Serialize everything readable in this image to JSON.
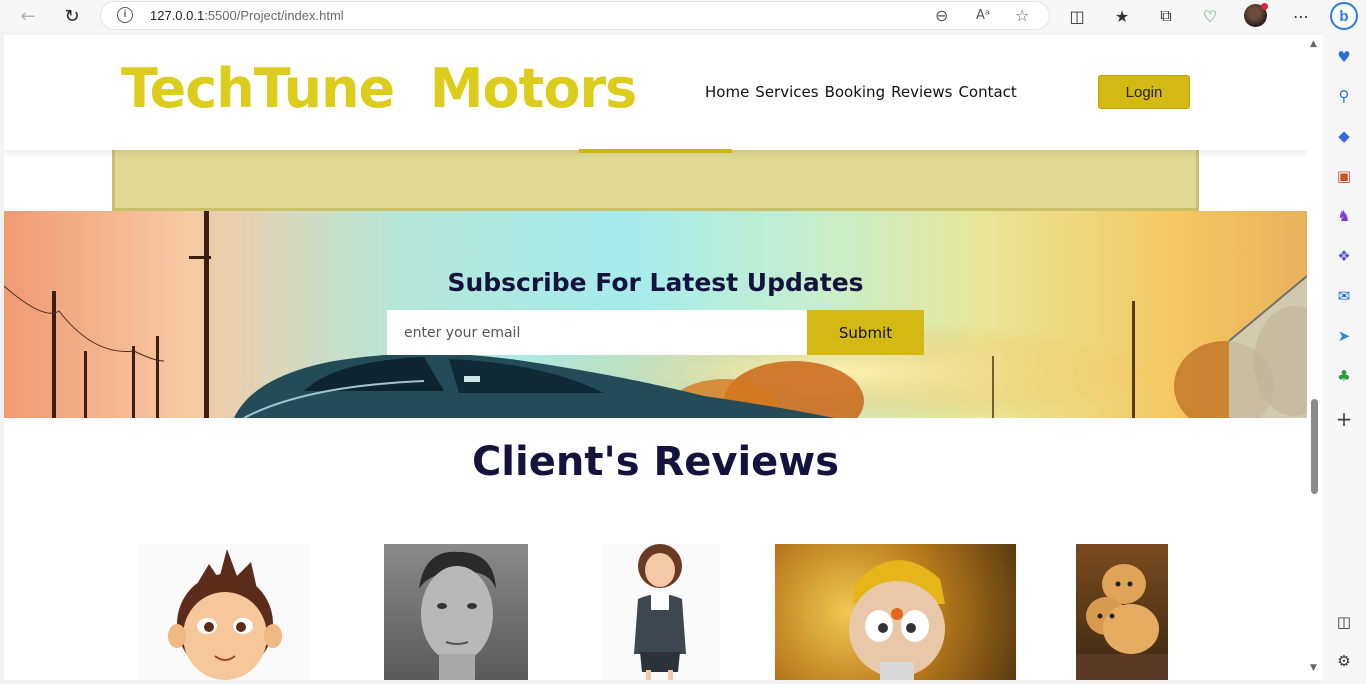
{
  "browser": {
    "url_host": "127.0.0.1",
    "url_rest": ":5500/Project/index.html"
  },
  "site": {
    "brand": "TechTune  Motors",
    "nav": [
      "Home",
      "Services",
      "Booking",
      "Reviews",
      "Contact"
    ],
    "login_label": "Login"
  },
  "subscribe": {
    "title": "Subscribe For Latest Updates",
    "email_placeholder": "enter your email",
    "submit_label": "Submit"
  },
  "reviews": {
    "title": "Client's Reviews"
  },
  "colors": {
    "brand": "#dccd1d",
    "accent": "#d4b914",
    "heading": "#14133d"
  }
}
